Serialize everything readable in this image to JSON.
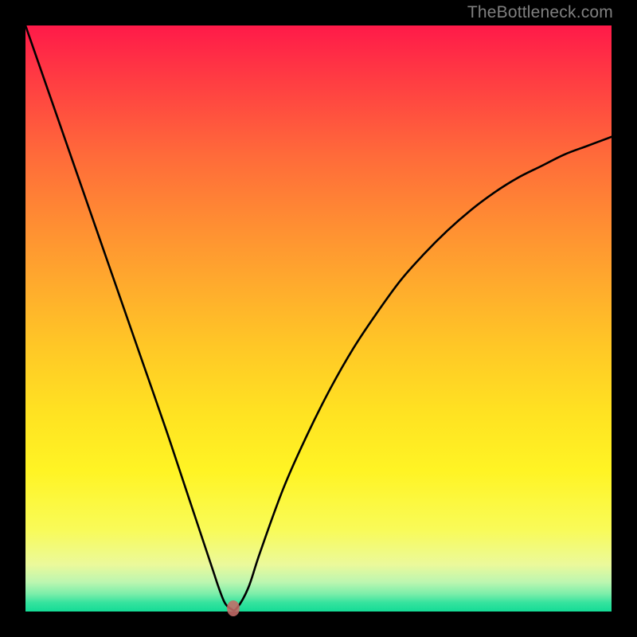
{
  "watermark": "TheBottleneck.com",
  "colors": {
    "frame": "#000000",
    "gradient_top": "#ff1a49",
    "gradient_mid": "#ffe222",
    "gradient_bottom": "#14db96",
    "curve": "#000000",
    "marker": "#c56b68"
  },
  "chart_data": {
    "type": "line",
    "title": "",
    "xlabel": "",
    "ylabel": "",
    "xlim": [
      0,
      100
    ],
    "ylim": [
      0,
      100
    ],
    "x": [
      0,
      4,
      8,
      12,
      16,
      20,
      24,
      28,
      30,
      32,
      33,
      34,
      35,
      36,
      38,
      40,
      44,
      48,
      52,
      56,
      60,
      64,
      68,
      72,
      76,
      80,
      84,
      88,
      92,
      96,
      100
    ],
    "y": [
      100,
      88.5,
      77,
      65.5,
      54,
      42.5,
      31,
      19,
      13,
      7,
      4,
      1.5,
      0.5,
      0.5,
      4,
      10,
      21,
      30,
      38,
      45,
      51,
      56.5,
      61,
      65,
      68.5,
      71.5,
      74,
      76,
      78,
      79.5,
      81
    ],
    "marker": {
      "x": 35.5,
      "y": 0.5
    },
    "gradient_stops": [
      {
        "pos": 0,
        "color": "#ff1a49"
      },
      {
        "pos": 50,
        "color": "#ffc826"
      },
      {
        "pos": 90,
        "color": "#f9fb58"
      },
      {
        "pos": 100,
        "color": "#14db96"
      }
    ]
  }
}
